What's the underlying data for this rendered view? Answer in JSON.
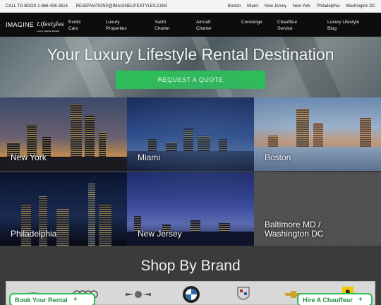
{
  "topbar": {
    "phone": "CALL TO BOOK 1-866-436-3514",
    "email": "RESERVATIONS@IMAGINELIFESTYLES.COM",
    "cities": [
      "Boston",
      "Miami",
      "New Jersey",
      "New York",
      "Philadelphia",
      "Washington DC"
    ]
  },
  "logo": {
    "word1": "IMAGINE",
    "word2": "Lifestyles",
    "tagline": "Luxury Lifestyle Rentals"
  },
  "nav": [
    {
      "line1": "Exotic",
      "line2": "Cars"
    },
    {
      "line1": "Luxury",
      "line2": "Properties"
    },
    {
      "line1": "Yacht",
      "line2": "Charter"
    },
    {
      "line1": "Aircraft",
      "line2": "Charter"
    },
    {
      "line1": "Concierge",
      "line2": ""
    },
    {
      "line1": "Chauffeur",
      "line2": "Service"
    },
    {
      "line1": "Luxury Lifestyle",
      "line2": "Blog"
    }
  ],
  "hero": {
    "title": "Your Luxury Lifestyle Rental Destination",
    "cta": "REQUEST A QUOTE"
  },
  "cities": [
    {
      "name": "New York"
    },
    {
      "name": "Miami"
    },
    {
      "name": "Boston"
    },
    {
      "name": "Philadelphia"
    },
    {
      "name": "New Jersey"
    },
    {
      "name": "Baltimore MD /",
      "name2": "Washington DC"
    }
  ],
  "brands": {
    "title": "Shop By Brand",
    "logos": [
      "lamborghini-icon",
      "audi-icon",
      "bentley-icon",
      "bmw-icon",
      "cadillac-icon",
      "chevrolet-icon",
      "ferrari-icon"
    ]
  },
  "floating": {
    "book": "Book Your Rental",
    "chauffeur": "Hire A Chauffeur",
    "plus": "+"
  },
  "colors": {
    "accent": "#2ebd59",
    "nav_bg": "#0d0d0d"
  }
}
